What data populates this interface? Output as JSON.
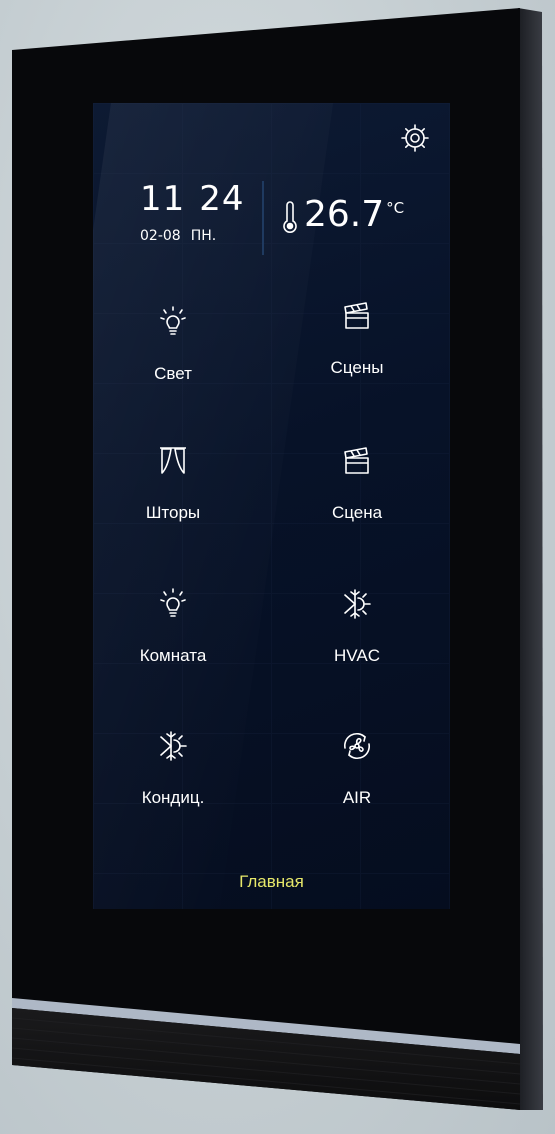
{
  "colors": {
    "bezel": "#07080b",
    "screen": "#071228",
    "icon": "#ffffff",
    "active_tab": "#e7e86a",
    "light_strip": "#aeb8c6"
  },
  "status": {
    "hours": "11",
    "minutes": "24",
    "date": "02-08",
    "weekday": "ПН.",
    "temperature": "26.7",
    "temperature_unit": "°C"
  },
  "tiles": [
    {
      "label": "Свет",
      "icon": "lightbulb-icon"
    },
    {
      "label": "Сцены",
      "icon": "clapperboard-icon"
    },
    {
      "label": "Шторы",
      "icon": "curtain-icon"
    },
    {
      "label": "Сцена",
      "icon": "clapperboard-icon"
    },
    {
      "label": "Комната",
      "icon": "lightbulb-icon"
    },
    {
      "label": "HVAC",
      "icon": "snowflake-sun-icon"
    },
    {
      "label": "Кондиц.",
      "icon": "snowflake-sun-icon"
    },
    {
      "label": "AIR",
      "icon": "fan-icon"
    }
  ],
  "footer": {
    "active_page": "Главная"
  }
}
